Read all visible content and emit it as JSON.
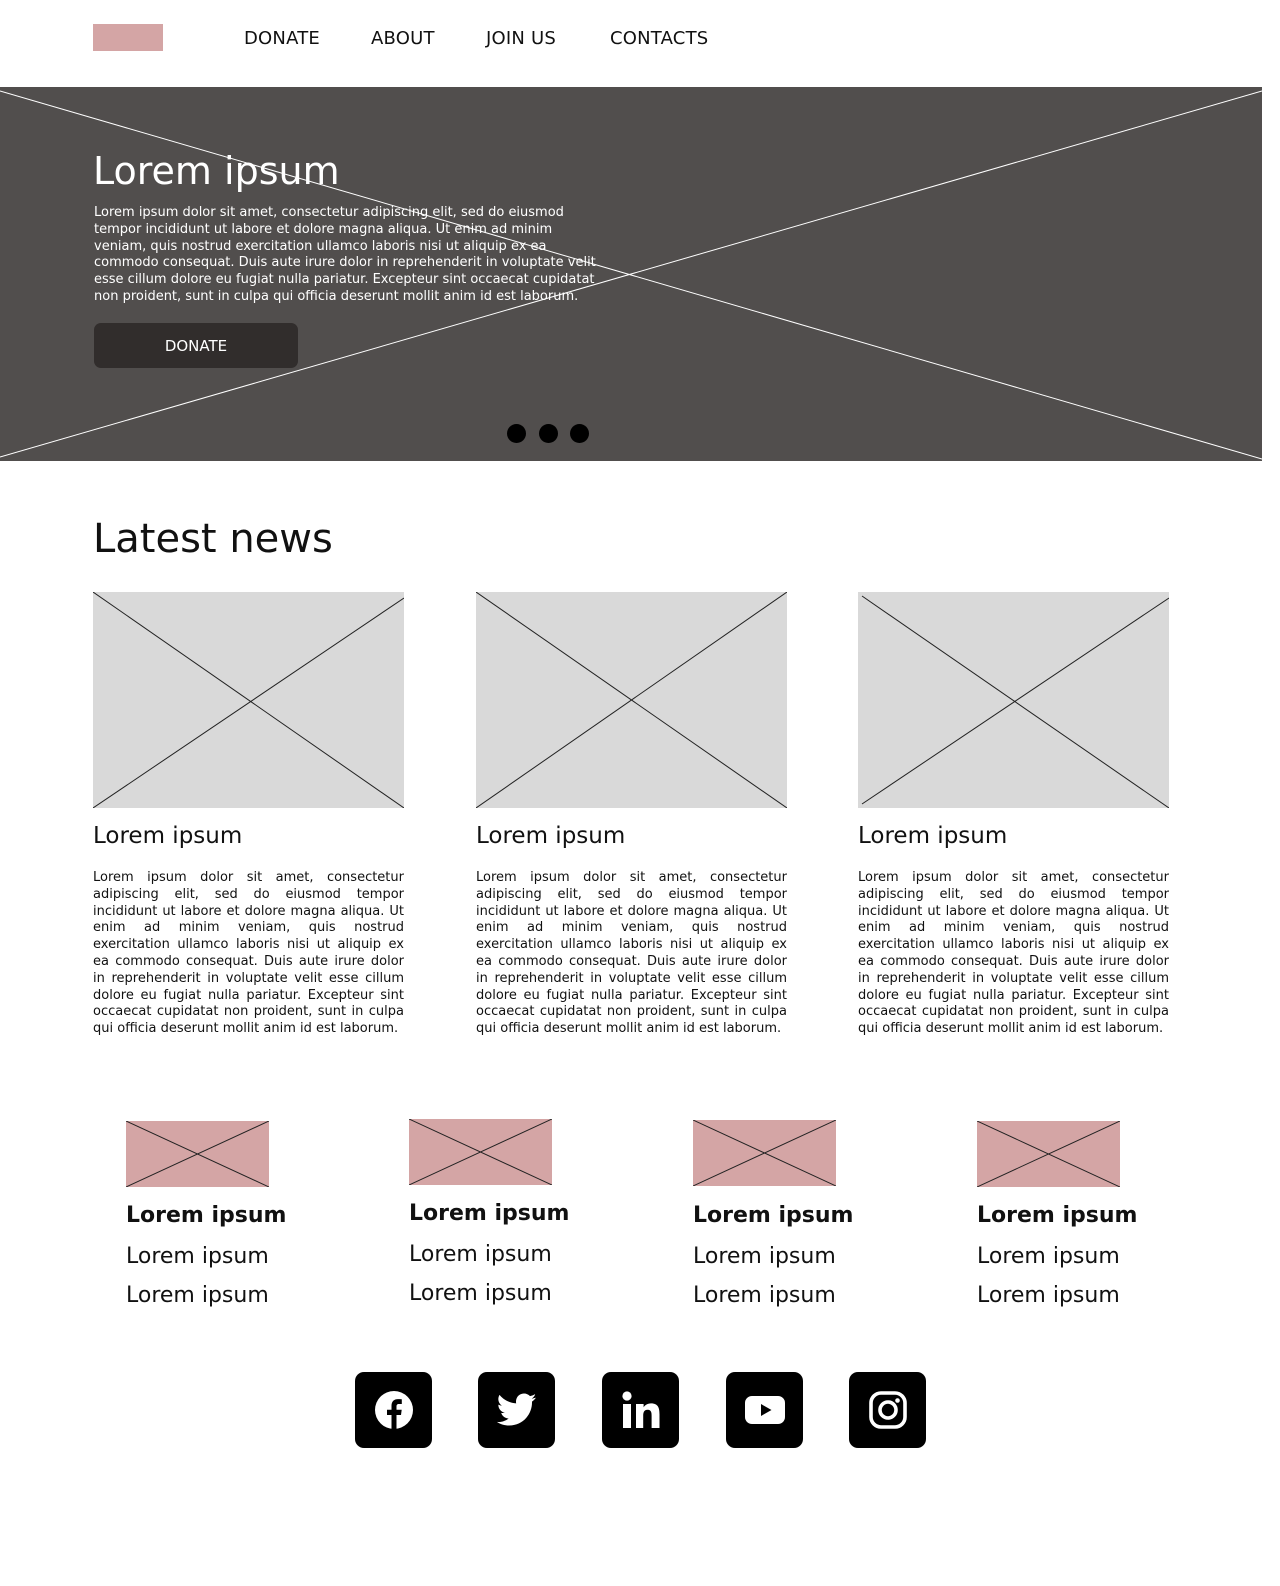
{
  "nav": {
    "items": [
      "DONATE",
      "ABOUT",
      "JOIN US",
      "CONTACTS"
    ]
  },
  "hero": {
    "title": "Lorem ipsum",
    "text": "Lorem ipsum dolor sit amet, consectetur adipiscing elit, sed do eiusmod tempor incididunt ut labore et dolore magna aliqua. Ut enim ad minim veniam, quis nostrud exercitation ullamco laboris nisi ut aliquip ex ea commodo consequat. Duis aute irure dolor in reprehenderit in voluptate velit esse cillum dolore eu fugiat nulla pariatur. Excepteur sint occaecat cupidatat non proident, sunt in culpa qui officia deserunt mollit anim id est laborum.",
    "button_label": "DONATE",
    "slides": 3,
    "background": "#514e4d"
  },
  "news": {
    "heading": "Latest news",
    "cards": [
      {
        "title": "Lorem ipsum",
        "text": "Lorem ipsum dolor sit amet, consectetur adipiscing elit, sed do eiusmod tempor incididunt ut labore et dolore magna aliqua. Ut enim ad minim veniam, quis nostrud exercitation ullamco laboris nisi ut aliquip ex ea commodo consequat. Duis aute irure dolor in reprehenderit in voluptate velit esse cillum dolore eu fugiat nulla pariatur. Excepteur sint occaecat cupidatat non proident, sunt in culpa qui officia deserunt mollit anim id est laborum."
      },
      {
        "title": "Lorem ipsum",
        "text": "Lorem ipsum dolor sit amet, consectetur adipiscing elit, sed do eiusmod tempor incididunt ut labore et dolore magna aliqua. Ut enim ad minim veniam, quis nostrud exercitation ullamco laboris nisi ut aliquip ex ea commodo consequat. Duis aute irure dolor in reprehenderit in voluptate velit esse cillum dolore eu fugiat nulla pariatur. Excepteur sint occaecat cupidatat non proident, sunt in culpa qui officia deserunt mollit anim id est laborum."
      },
      {
        "title": "Lorem ipsum",
        "text": "Lorem ipsum dolor sit amet, consectetur adipiscing elit, sed do eiusmod tempor incididunt ut labore et dolore magna aliqua. Ut enim ad minim veniam, quis nostrud exercitation ullamco laboris nisi ut aliquip ex ea commodo consequat. Duis aute irure dolor in reprehenderit in voluptate velit esse cillum dolore eu fugiat nulla pariatur. Excepteur sint occaecat cupidatat non proident, sunt in culpa qui officia deserunt mollit anim id est laborum."
      }
    ]
  },
  "footer": {
    "columns": [
      {
        "heading": "Lorem ipsum",
        "links": [
          "Lorem ipsum",
          "Lorem ipsum"
        ]
      },
      {
        "heading": "Lorem ipsum",
        "links": [
          "Lorem ipsum",
          "Lorem ipsum"
        ]
      },
      {
        "heading": "Lorem ipsum",
        "links": [
          "Lorem ipsum",
          "Lorem ipsum"
        ]
      },
      {
        "heading": "Lorem ipsum",
        "links": [
          "Lorem ipsum",
          "Lorem ipsum"
        ]
      }
    ],
    "social_icons": [
      "facebook-icon",
      "twitter-icon",
      "linkedin-icon",
      "youtube-icon",
      "instagram-icon"
    ]
  },
  "colors": {
    "accent": "#d4a5a5",
    "hero_bg": "#514e4d",
    "button_bg": "#312d2c",
    "placeholder_bg": "#d9d9d9"
  }
}
